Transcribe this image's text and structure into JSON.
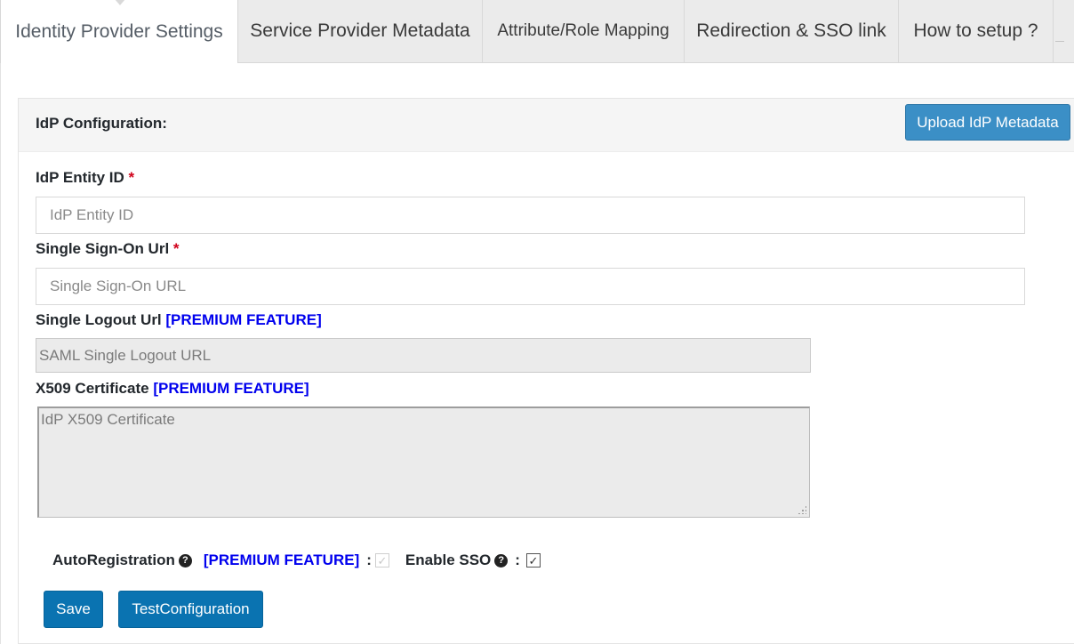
{
  "tabs": [
    {
      "label": "Identity Provider Settings",
      "active": true
    },
    {
      "label": "Service Provider Metadata",
      "active": false
    },
    {
      "label": "Attribute/Role Mapping",
      "active": false
    },
    {
      "label": "Redirection & SSO link",
      "active": false
    },
    {
      "label": "How to setup ?",
      "active": false
    }
  ],
  "panel": {
    "title": "IdP Configuration:",
    "upload_button": "Upload IdP Metadata"
  },
  "form": {
    "entity_id": {
      "label": "IdP Entity ID",
      "required": "*",
      "placeholder": "IdP Entity ID"
    },
    "sso_url": {
      "label": "Single Sign-On Url",
      "required": "*",
      "placeholder": "Single Sign-On URL"
    },
    "logout_url": {
      "label": "Single Logout Url",
      "premium": "[PREMIUM FEATURE]",
      "placeholder": "SAML Single Logout URL"
    },
    "certificate": {
      "label": "X509 Certificate",
      "premium": "[PREMIUM FEATURE]",
      "placeholder": "IdP X509 Certificate"
    }
  },
  "options": {
    "autoregistration": {
      "label": "AutoRegistration",
      "premium": "[PREMIUM FEATURE]",
      "colon": ":",
      "checked": true,
      "disabled": true
    },
    "enable_sso": {
      "label": "Enable SSO",
      "colon": ":",
      "checked": true
    }
  },
  "buttons": {
    "save": "Save",
    "test": "TestConfiguration"
  },
  "icons": {
    "question": "question-circle-icon",
    "check": "✓",
    "help_glyph": "?"
  },
  "colors": {
    "tab_bg": "#ebebeb",
    "primary": "#0a73b1",
    "upload": "#3b8fc6",
    "premium": "#0000ee",
    "required": "#d0021b"
  }
}
